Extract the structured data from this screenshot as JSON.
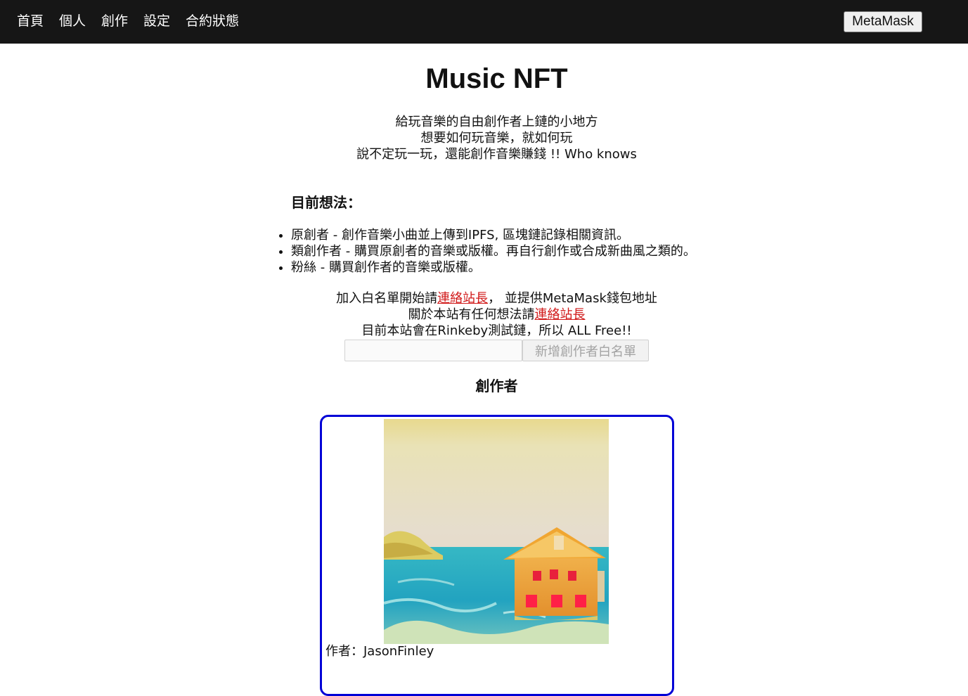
{
  "nav": {
    "items": [
      "首頁",
      "個人",
      "創作",
      "設定",
      "合約狀態"
    ],
    "wallet_button": "MetaMask"
  },
  "hero": {
    "title": "Music NFT",
    "lines": [
      "給玩音樂的自由創作者上鏈的小地方",
      "想要如何玩音樂，就如何玩",
      "說不定玩一玩，還能創作音樂賺錢 !! Who knows"
    ]
  },
  "ideas": {
    "heading": "目前想法：",
    "items": [
      "原創者 - 創作音樂小曲並上傳到IPFS, 區塊鏈記錄相關資訊。",
      "類創作者 - 購買原創者的音樂或版權。再自行創作或合成新曲風之類的。",
      "粉絲 - 購買創作者的音樂或版權。"
    ]
  },
  "whitelist": {
    "line1_prefix": "加入白名單開始請",
    "line1_link": "連絡站長",
    "line1_suffix": "， 並提供MetaMask錢包地址",
    "line2_prefix": "關於本站有任何想法請",
    "line2_link": "連絡站長",
    "line3": "目前本站會在Rinkeby測試鏈，所以 ALL Free!!",
    "input_value": "",
    "button_label": "新增創作者白名單"
  },
  "creators": {
    "heading": "創作者",
    "card": {
      "author_label": "作者：",
      "author_name": "JasonFinley"
    }
  },
  "colors": {
    "navbar_bg": "#161616",
    "link": "#d11a1a",
    "card_border": "#0000d6"
  }
}
